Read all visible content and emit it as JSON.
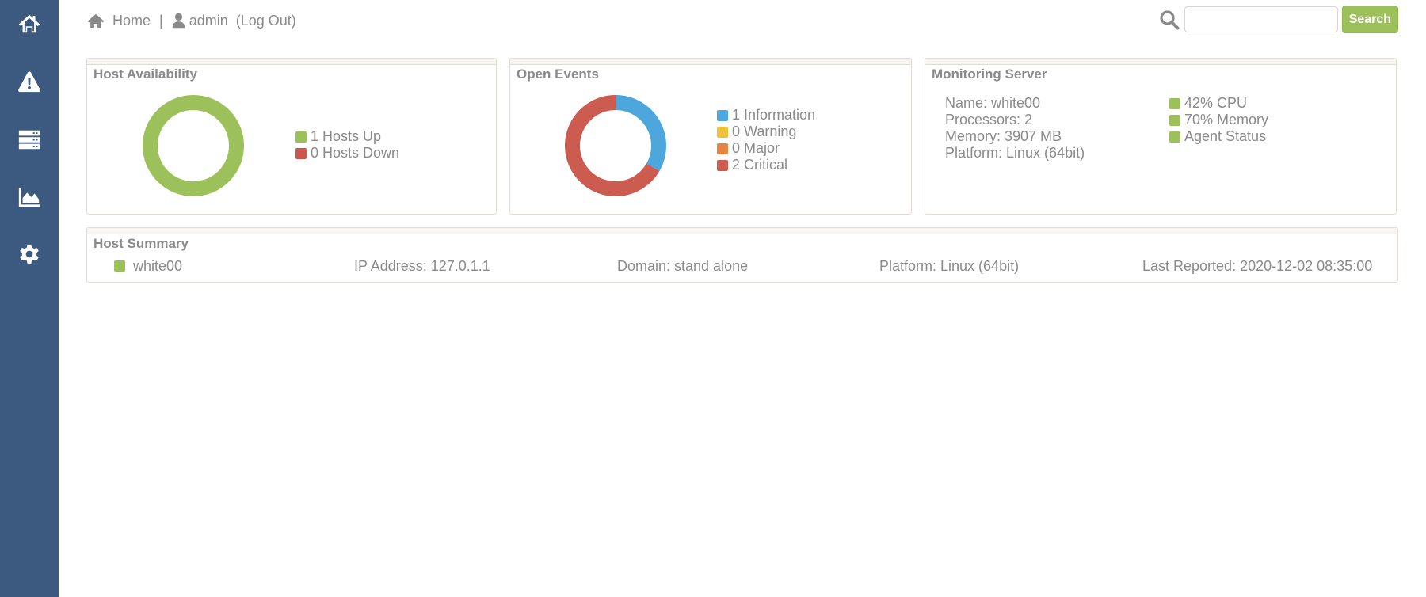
{
  "sidebar": {
    "items": [
      {
        "icon": "home-icon"
      },
      {
        "icon": "warning-icon"
      },
      {
        "icon": "server-icon"
      },
      {
        "icon": "area-chart-icon"
      },
      {
        "icon": "gear-icon"
      }
    ]
  },
  "header": {
    "home_label": "Home",
    "separator": "|",
    "user_label": "admin",
    "logout_label": "(Log Out)"
  },
  "search": {
    "value": "",
    "placeholder": "",
    "button_label": "Search"
  },
  "colors": {
    "sidebar": "#3c5a80",
    "up": "#9dc15a",
    "down": "#c8584e",
    "information": "#4da7dc",
    "warning": "#f0c13a",
    "major": "#e58441",
    "critical": "#cc5b50"
  },
  "host_availability": {
    "title": "Host Availability",
    "legend": [
      {
        "label": "1 Hosts Up",
        "color": "#9dc15a"
      },
      {
        "label": "0 Hosts Down",
        "color": "#c8584e"
      }
    ],
    "chart_data": {
      "type": "pie",
      "categories": [
        "Hosts Up",
        "Hosts Down"
      ],
      "values": [
        1,
        0
      ],
      "colors": [
        "#9dc15a",
        "#c8584e"
      ],
      "title": ""
    }
  },
  "open_events": {
    "title": "Open Events",
    "legend": [
      {
        "label": "1 Information",
        "color": "#4da7dc"
      },
      {
        "label": "0 Warning",
        "color": "#f0c13a"
      },
      {
        "label": "0 Major",
        "color": "#e58441"
      },
      {
        "label": "2 Critical",
        "color": "#cc5b50"
      }
    ],
    "chart_data": {
      "type": "pie",
      "categories": [
        "Information",
        "Warning",
        "Major",
        "Critical"
      ],
      "values": [
        1,
        0,
        0,
        2
      ],
      "colors": [
        "#4da7dc",
        "#f0c13a",
        "#e58441",
        "#cc5b50"
      ],
      "title": ""
    }
  },
  "monitoring_server": {
    "title": "Monitoring Server",
    "details": [
      "Name: white00",
      "Processors: 2",
      "Memory: 3907 MB",
      "Platform: Linux (64bit)"
    ],
    "metrics": [
      {
        "label": "42% CPU",
        "color": "#9dc15a"
      },
      {
        "label": "70% Memory",
        "color": "#9dc15a"
      },
      {
        "label": "Agent Status",
        "color": "#9dc15a"
      }
    ]
  },
  "host_summary": {
    "title": "Host Summary",
    "hosts": [
      {
        "status_color": "#9dc15a",
        "name": "white00",
        "ip": "IP Address: 127.0.1.1",
        "domain": "Domain: stand alone",
        "platform": "Platform: Linux (64bit)",
        "last_reported": "Last Reported: 2020-12-02 08:35:00"
      }
    ]
  }
}
